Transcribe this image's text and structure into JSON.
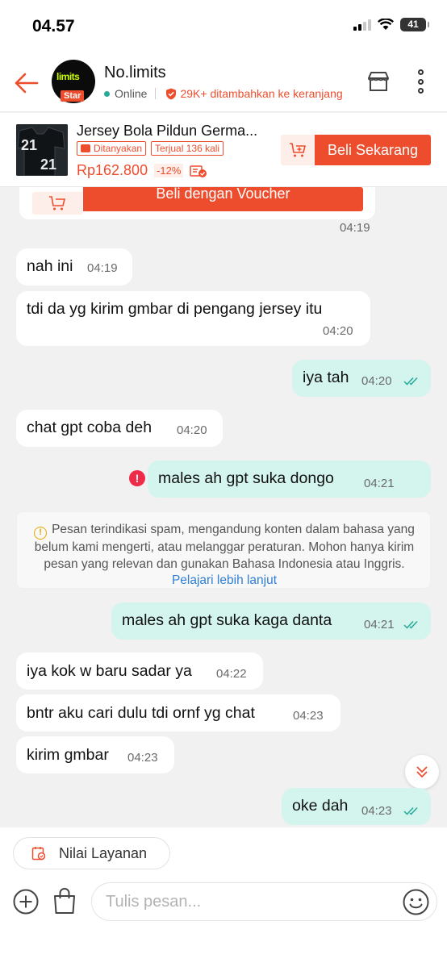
{
  "status_bar": {
    "time": "04.57",
    "battery": "41"
  },
  "header": {
    "shop_name": "No.limits",
    "badge": "Star",
    "avatar_text": "limits",
    "online": "Online",
    "cart_added": "29K+ ditambahkan ke keranjang"
  },
  "product": {
    "title": "Jersey Bola Pildun Germa...",
    "tag_asked": "Ditanyakan",
    "tag_sold": "Terjual 136 kali",
    "price": "Rp162.800",
    "discount": "-12%",
    "buy_label": "Beli Sekarang"
  },
  "voucher": {
    "button_label": "Beli dengan Voucher",
    "time": "04:19"
  },
  "messages": [
    {
      "dir": "in",
      "text": "nah ini",
      "time": "04:19"
    },
    {
      "dir": "in",
      "text": "tdi da yg kirim gmbar di pengang jersey itu",
      "time": "04:20"
    },
    {
      "dir": "out",
      "text": "iya tah",
      "time": "04:20"
    },
    {
      "dir": "in",
      "text": "chat gpt coba deh",
      "time": "04:20"
    },
    {
      "dir": "out",
      "text": "males ah gpt suka dongo",
      "time": "04:21",
      "failed": true
    },
    {
      "dir": "out",
      "text": "males ah gpt suka kaga danta",
      "time": "04:21"
    },
    {
      "dir": "in",
      "text": "iya kok w baru sadar ya",
      "time": "04:22"
    },
    {
      "dir": "in",
      "text": "bntr aku cari dulu tdi ornf yg chat",
      "time": "04:23"
    },
    {
      "dir": "in",
      "text": "kirim gmbar",
      "time": "04:23"
    },
    {
      "dir": "out",
      "text": "oke dah",
      "time": "04:23"
    }
  ],
  "spam_notice": {
    "text": "Pesan terindikasi spam, mengandung konten dalam bahasa yang belum kami mengerti, atau melanggar peraturan. Mohon hanya kirim pesan yang relevan dan gunakan Bahasa Indonesia atau Inggris.",
    "link": "Pelajari lebih lanjut"
  },
  "bottom": {
    "rate_label": "Nilai Layanan",
    "input_placeholder": "Tulis pesan..."
  },
  "colors": {
    "accent": "#ee4d2d",
    "outgoing_bubble": "#d4f4ee",
    "incoming_bubble": "#ffffff",
    "online": "#26aa99",
    "link": "#2f7fd6"
  },
  "icons": [
    "back-arrow-icon",
    "shop-icon",
    "more-vertical-icon",
    "cart-plus-icon",
    "warning-icon",
    "error-icon",
    "read-tick-icon",
    "chevron-double-down-icon",
    "rate-service-icon",
    "plus-circle-icon",
    "shopping-bag-icon",
    "emoji-icon"
  ]
}
